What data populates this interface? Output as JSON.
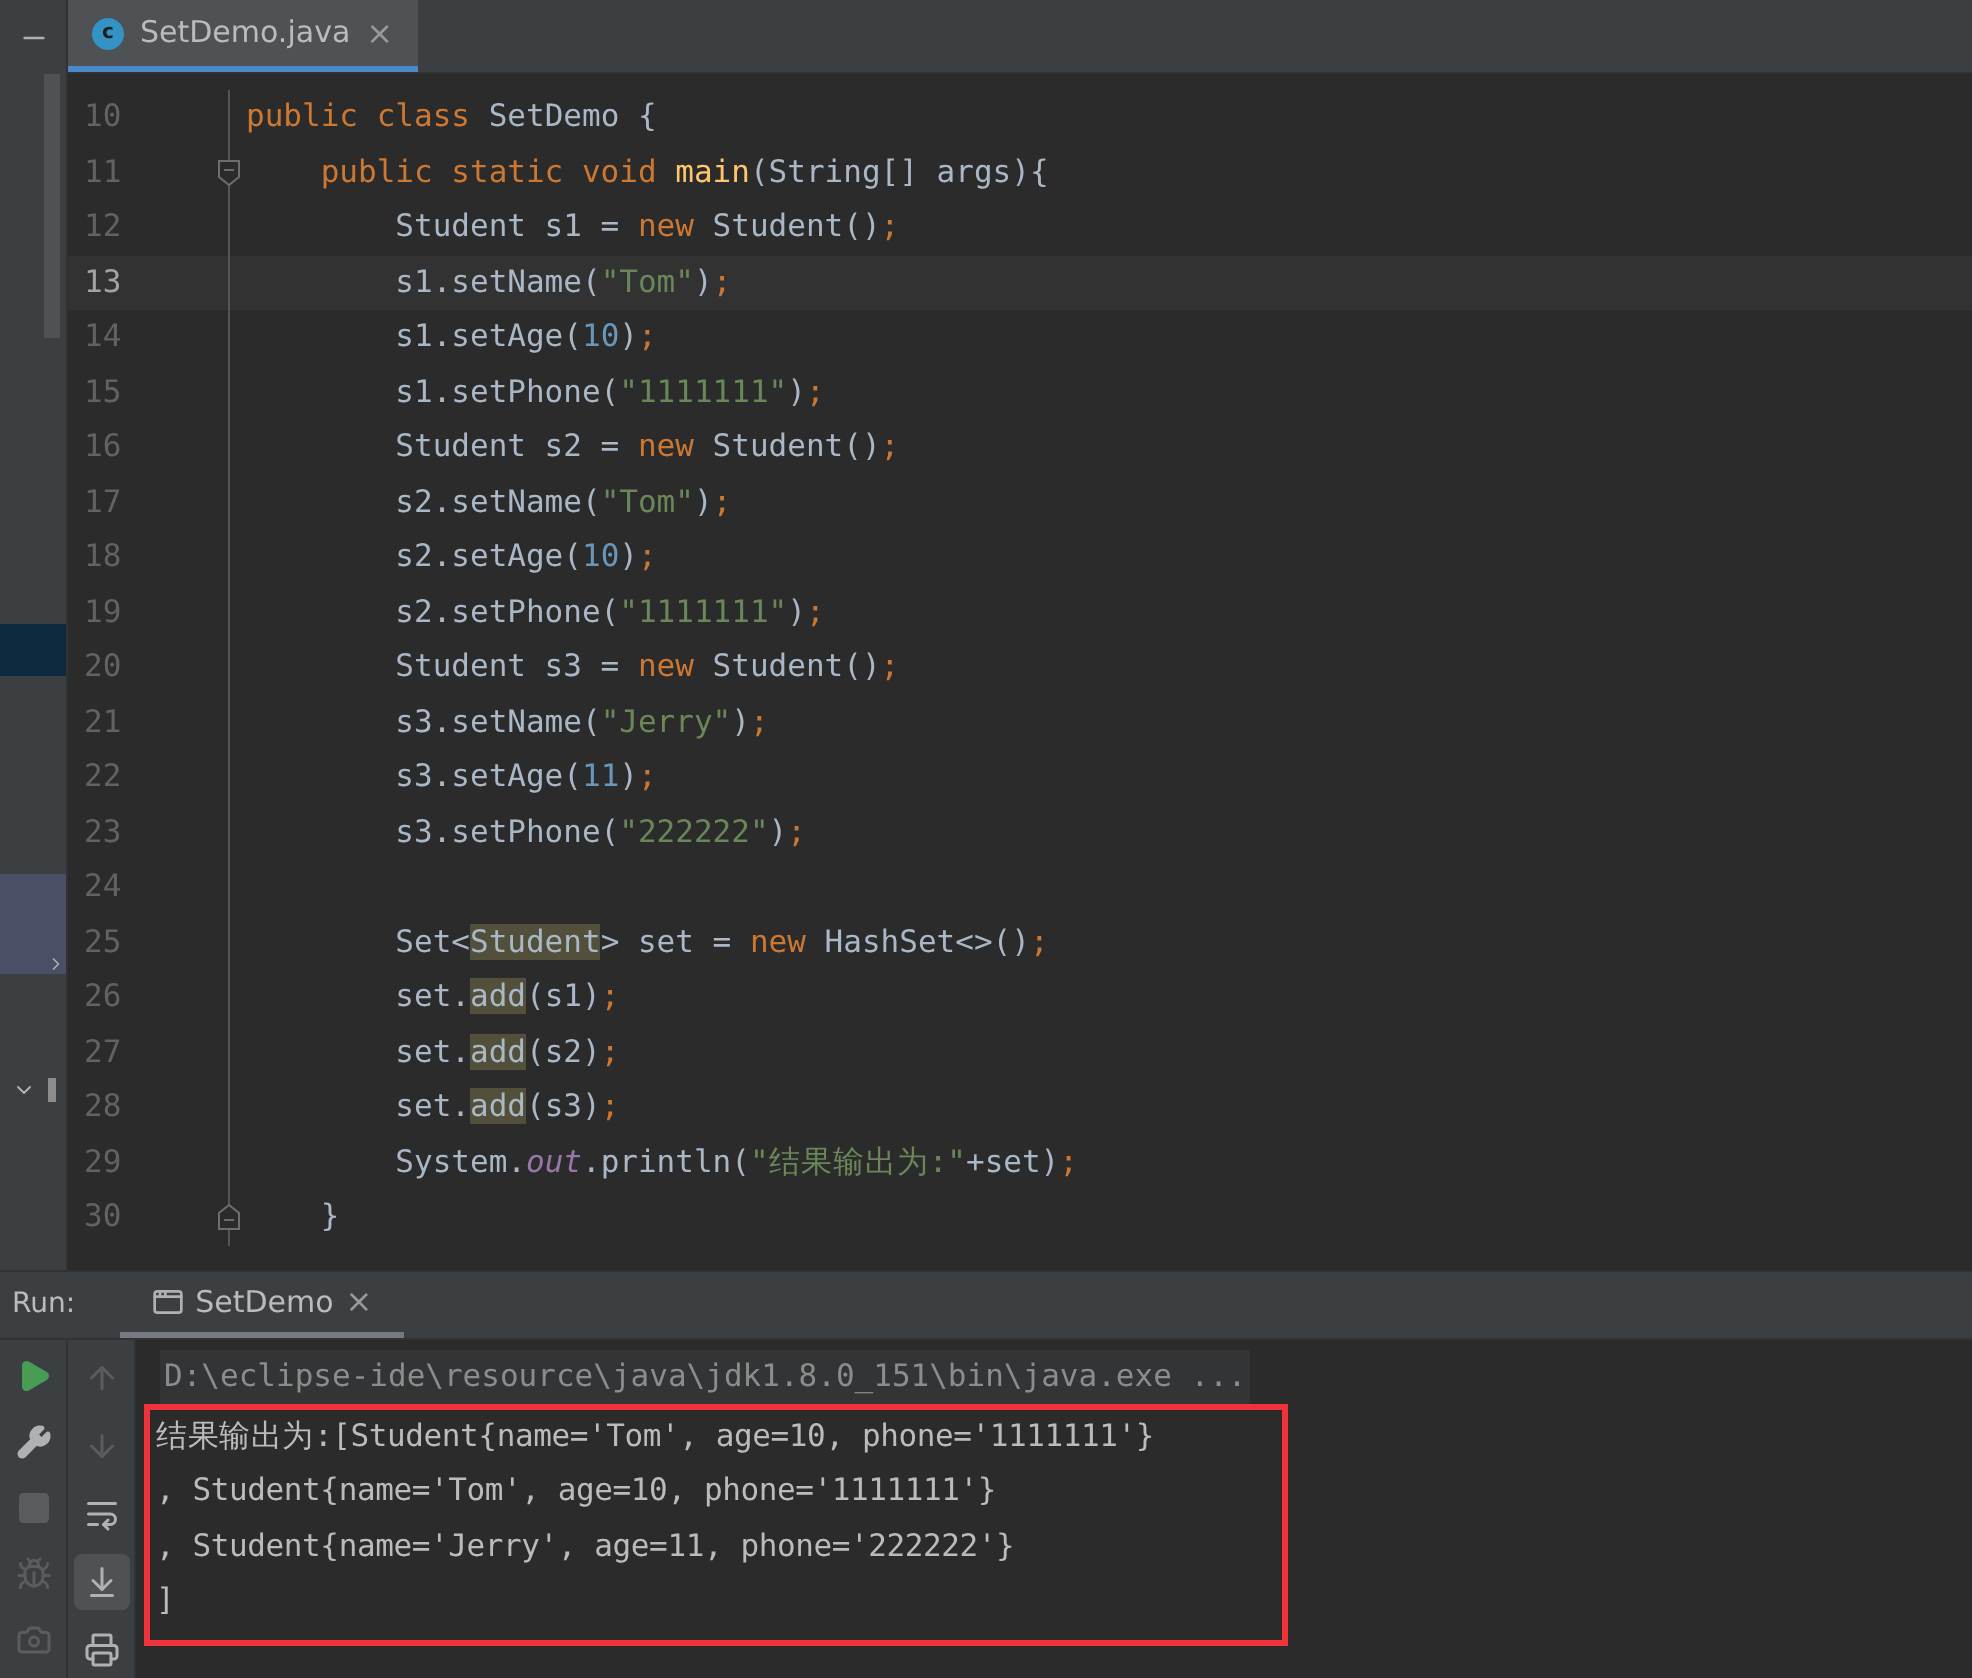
{
  "editor_tab": {
    "icon_text": "c",
    "label": "SetDemo.java",
    "close": "×",
    "selected": true
  },
  "code_lines": [
    {
      "number": "10",
      "kind": "code",
      "tokens": [
        {
          "t": "public class ",
          "kind": "kw"
        },
        {
          "t": "SetDemo {",
          "kind": "plain"
        }
      ]
    },
    {
      "number": "11",
      "kind": "fold-start",
      "tokens": [
        {
          "t": "    public static void ",
          "kind": "kw"
        },
        {
          "t": "main",
          "kind": "fn"
        },
        {
          "t": "(String[] args){",
          "kind": "plain"
        }
      ]
    },
    {
      "number": "12",
      "kind": "code",
      "tokens": [
        {
          "t": "        Student s1 = ",
          "kind": "plain"
        },
        {
          "t": "new ",
          "kind": "kw"
        },
        {
          "t": "Student()",
          "kind": "plain"
        },
        {
          "t": ";",
          "kind": "kw"
        }
      ]
    },
    {
      "number": "13",
      "kind": "code",
      "current": true,
      "tokens": [
        {
          "t": "        s1.setName(",
          "kind": "plain"
        },
        {
          "t": "\"Tom\"",
          "kind": "str"
        },
        {
          "t": ")",
          "kind": "plain"
        },
        {
          "t": ";",
          "kind": "kw"
        }
      ]
    },
    {
      "number": "14",
      "kind": "code",
      "tokens": [
        {
          "t": "        s1.setAge(",
          "kind": "plain"
        },
        {
          "t": "10",
          "kind": "num"
        },
        {
          "t": ")",
          "kind": "plain"
        },
        {
          "t": ";",
          "kind": "kw"
        }
      ]
    },
    {
      "number": "15",
      "kind": "code",
      "tokens": [
        {
          "t": "        s1.setPhone(",
          "kind": "plain"
        },
        {
          "t": "\"1111111\"",
          "kind": "str"
        },
        {
          "t": ")",
          "kind": "plain"
        },
        {
          "t": ";",
          "kind": "kw"
        }
      ]
    },
    {
      "number": "16",
      "kind": "code",
      "tokens": [
        {
          "t": "        Student s2 = ",
          "kind": "plain"
        },
        {
          "t": "new ",
          "kind": "kw"
        },
        {
          "t": "Student()",
          "kind": "plain"
        },
        {
          "t": ";",
          "kind": "kw"
        }
      ]
    },
    {
      "number": "17",
      "kind": "code",
      "tokens": [
        {
          "t": "        s2.setName(",
          "kind": "plain"
        },
        {
          "t": "\"Tom\"",
          "kind": "str"
        },
        {
          "t": ")",
          "kind": "plain"
        },
        {
          "t": ";",
          "kind": "kw"
        }
      ]
    },
    {
      "number": "18",
      "kind": "code",
      "tokens": [
        {
          "t": "        s2.setAge(",
          "kind": "plain"
        },
        {
          "t": "10",
          "kind": "num"
        },
        {
          "t": ")",
          "kind": "plain"
        },
        {
          "t": ";",
          "kind": "kw"
        }
      ]
    },
    {
      "number": "19",
      "kind": "code",
      "tokens": [
        {
          "t": "        s2.setPhone(",
          "kind": "plain"
        },
        {
          "t": "\"1111111\"",
          "kind": "str"
        },
        {
          "t": ")",
          "kind": "plain"
        },
        {
          "t": ";",
          "kind": "kw"
        }
      ]
    },
    {
      "number": "20",
      "kind": "code",
      "tokens": [
        {
          "t": "        Student s3 = ",
          "kind": "plain"
        },
        {
          "t": "new ",
          "kind": "kw"
        },
        {
          "t": "Student()",
          "kind": "plain"
        },
        {
          "t": ";",
          "kind": "kw"
        }
      ]
    },
    {
      "number": "21",
      "kind": "code",
      "tokens": [
        {
          "t": "        s3.setName(",
          "kind": "plain"
        },
        {
          "t": "\"Jerry\"",
          "kind": "str"
        },
        {
          "t": ")",
          "kind": "plain"
        },
        {
          "t": ";",
          "kind": "kw"
        }
      ]
    },
    {
      "number": "22",
      "kind": "code",
      "tokens": [
        {
          "t": "        s3.setAge(",
          "kind": "plain"
        },
        {
          "t": "11",
          "kind": "num"
        },
        {
          "t": ")",
          "kind": "plain"
        },
        {
          "t": ";",
          "kind": "kw"
        }
      ]
    },
    {
      "number": "23",
      "kind": "code",
      "tokens": [
        {
          "t": "        s3.setPhone(",
          "kind": "plain"
        },
        {
          "t": "\"222222\"",
          "kind": "str"
        },
        {
          "t": ")",
          "kind": "plain"
        },
        {
          "t": ";",
          "kind": "kw"
        }
      ]
    },
    {
      "number": "24",
      "kind": "blank"
    },
    {
      "number": "25",
      "kind": "code",
      "tokens": [
        {
          "t": "        Set<",
          "kind": "plain"
        },
        {
          "t": "Student",
          "kind": "hl"
        },
        {
          "t": "> set = ",
          "kind": "plain"
        },
        {
          "t": "new ",
          "kind": "kw"
        },
        {
          "t": "HashSet<>()",
          "kind": "plain"
        },
        {
          "t": ";",
          "kind": "kw"
        }
      ]
    },
    {
      "number": "26",
      "kind": "code",
      "tokens": [
        {
          "t": "        set.",
          "kind": "plain"
        },
        {
          "t": "add",
          "kind": "hl"
        },
        {
          "t": "(s1)",
          "kind": "plain"
        },
        {
          "t": ";",
          "kind": "kw"
        }
      ]
    },
    {
      "number": "27",
      "kind": "code",
      "tokens": [
        {
          "t": "        set.",
          "kind": "plain"
        },
        {
          "t": "add",
          "kind": "hl"
        },
        {
          "t": "(s2)",
          "kind": "plain"
        },
        {
          "t": ";",
          "kind": "kw"
        }
      ]
    },
    {
      "number": "28",
      "kind": "code",
      "tokens": [
        {
          "t": "        set.",
          "kind": "plain"
        },
        {
          "t": "add",
          "kind": "hl"
        },
        {
          "t": "(s3)",
          "kind": "plain"
        },
        {
          "t": ";",
          "kind": "kw"
        }
      ]
    },
    {
      "number": "29",
      "kind": "code",
      "tokens": [
        {
          "t": "        System.",
          "kind": "plain"
        },
        {
          "t": "out",
          "kind": "field"
        },
        {
          "t": ".println(",
          "kind": "plain"
        },
        {
          "t": "\"结果输出为:\"",
          "kind": "str"
        },
        {
          "t": "+set)",
          "kind": "plain"
        },
        {
          "t": ";",
          "kind": "kw"
        }
      ]
    },
    {
      "number": "30",
      "kind": "fold-end",
      "tokens": [
        {
          "t": "    }",
          "kind": "plain"
        }
      ]
    }
  ],
  "run_panel": {
    "title": "Run:",
    "tab": {
      "label": "SetDemo",
      "close": "×",
      "selected": true
    },
    "tools_left": [
      {
        "kind": "play"
      },
      {
        "kind": "wrench"
      },
      {
        "kind": "stop"
      },
      {
        "kind": "bug"
      },
      {
        "kind": "camera"
      }
    ],
    "tools_right": [
      {
        "kind": "up",
        "selected": false
      },
      {
        "kind": "down",
        "selected": false
      },
      {
        "kind": "wrap",
        "selected": false
      },
      {
        "kind": "scroll-end",
        "selected": true
      },
      {
        "kind": "print",
        "selected": false
      }
    ],
    "command": "D:\\eclipse-ide\\resource\\java\\jdk1.8.0_151\\bin\\java.exe ...",
    "output": {
      "highlighted": true,
      "lines": [
        "结果输出为:[Student{name='Tom', age=10, phone='1111111'}",
        ", Student{name='Tom', age=10, phone='1111111'}",
        ", Student{name='Jerry', age=11, phone='222222'}",
        "]"
      ]
    }
  }
}
